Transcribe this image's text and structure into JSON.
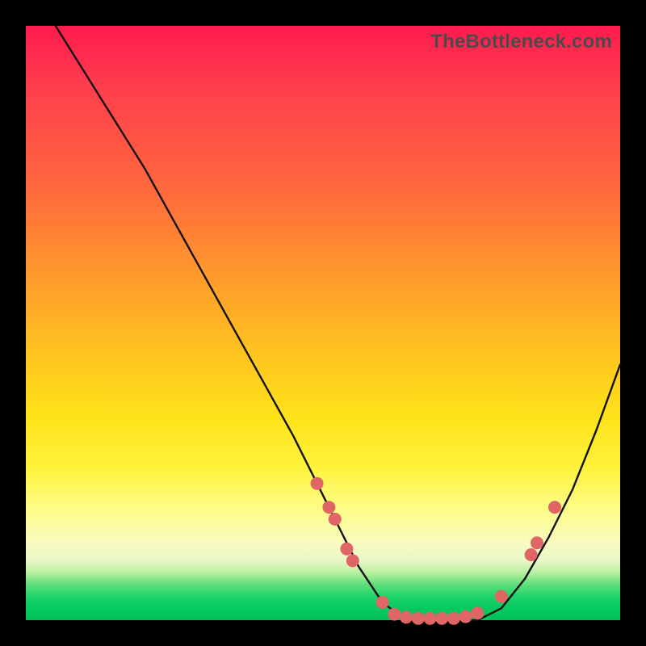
{
  "watermark": "TheBottleneck.com",
  "colors": {
    "curve": "#111111",
    "dot": "#e06666",
    "gradient_top": "#ff1a4d",
    "gradient_bottom": "#02c259",
    "frame": "#000000"
  },
  "chart_data": {
    "type": "line",
    "title": "",
    "xlabel": "",
    "ylabel": "",
    "xlim": [
      0,
      100
    ],
    "ylim": [
      0,
      100
    ],
    "grid": false,
    "legend": false,
    "series": [
      {
        "name": "bottleneck-curve",
        "x": [
          5,
          10,
          15,
          20,
          25,
          30,
          35,
          40,
          45,
          49,
          53,
          56,
          60,
          64,
          68,
          72,
          76,
          80,
          84,
          88,
          92,
          96,
          100
        ],
        "y": [
          100,
          92,
          84,
          76,
          67,
          58,
          49,
          40,
          31,
          23,
          15,
          9,
          3,
          0,
          0,
          0,
          0,
          2,
          7,
          14,
          22,
          32,
          43
        ]
      }
    ],
    "markers": [
      {
        "name": "left-descent-dot-1",
        "x": 49,
        "y": 23
      },
      {
        "name": "left-descent-dot-2",
        "x": 51,
        "y": 19
      },
      {
        "name": "left-descent-dot-3",
        "x": 52,
        "y": 17
      },
      {
        "name": "left-descent-dot-4",
        "x": 54,
        "y": 12
      },
      {
        "name": "left-descent-dot-5",
        "x": 55,
        "y": 10
      },
      {
        "name": "floor-dot-1",
        "x": 60,
        "y": 3
      },
      {
        "name": "floor-dot-2",
        "x": 62,
        "y": 1
      },
      {
        "name": "floor-dot-3",
        "x": 64,
        "y": 0.5
      },
      {
        "name": "floor-dot-4",
        "x": 66,
        "y": 0.3
      },
      {
        "name": "floor-dot-5",
        "x": 68,
        "y": 0.3
      },
      {
        "name": "floor-dot-6",
        "x": 70,
        "y": 0.3
      },
      {
        "name": "floor-dot-7",
        "x": 72,
        "y": 0.3
      },
      {
        "name": "floor-dot-8",
        "x": 74,
        "y": 0.6
      },
      {
        "name": "floor-dot-9",
        "x": 76,
        "y": 1.2
      },
      {
        "name": "right-ascent-dot-1",
        "x": 80,
        "y": 4
      },
      {
        "name": "right-ascent-dot-2",
        "x": 85,
        "y": 11
      },
      {
        "name": "right-ascent-dot-3",
        "x": 86,
        "y": 13
      },
      {
        "name": "right-ascent-dot-4",
        "x": 89,
        "y": 19
      }
    ]
  }
}
